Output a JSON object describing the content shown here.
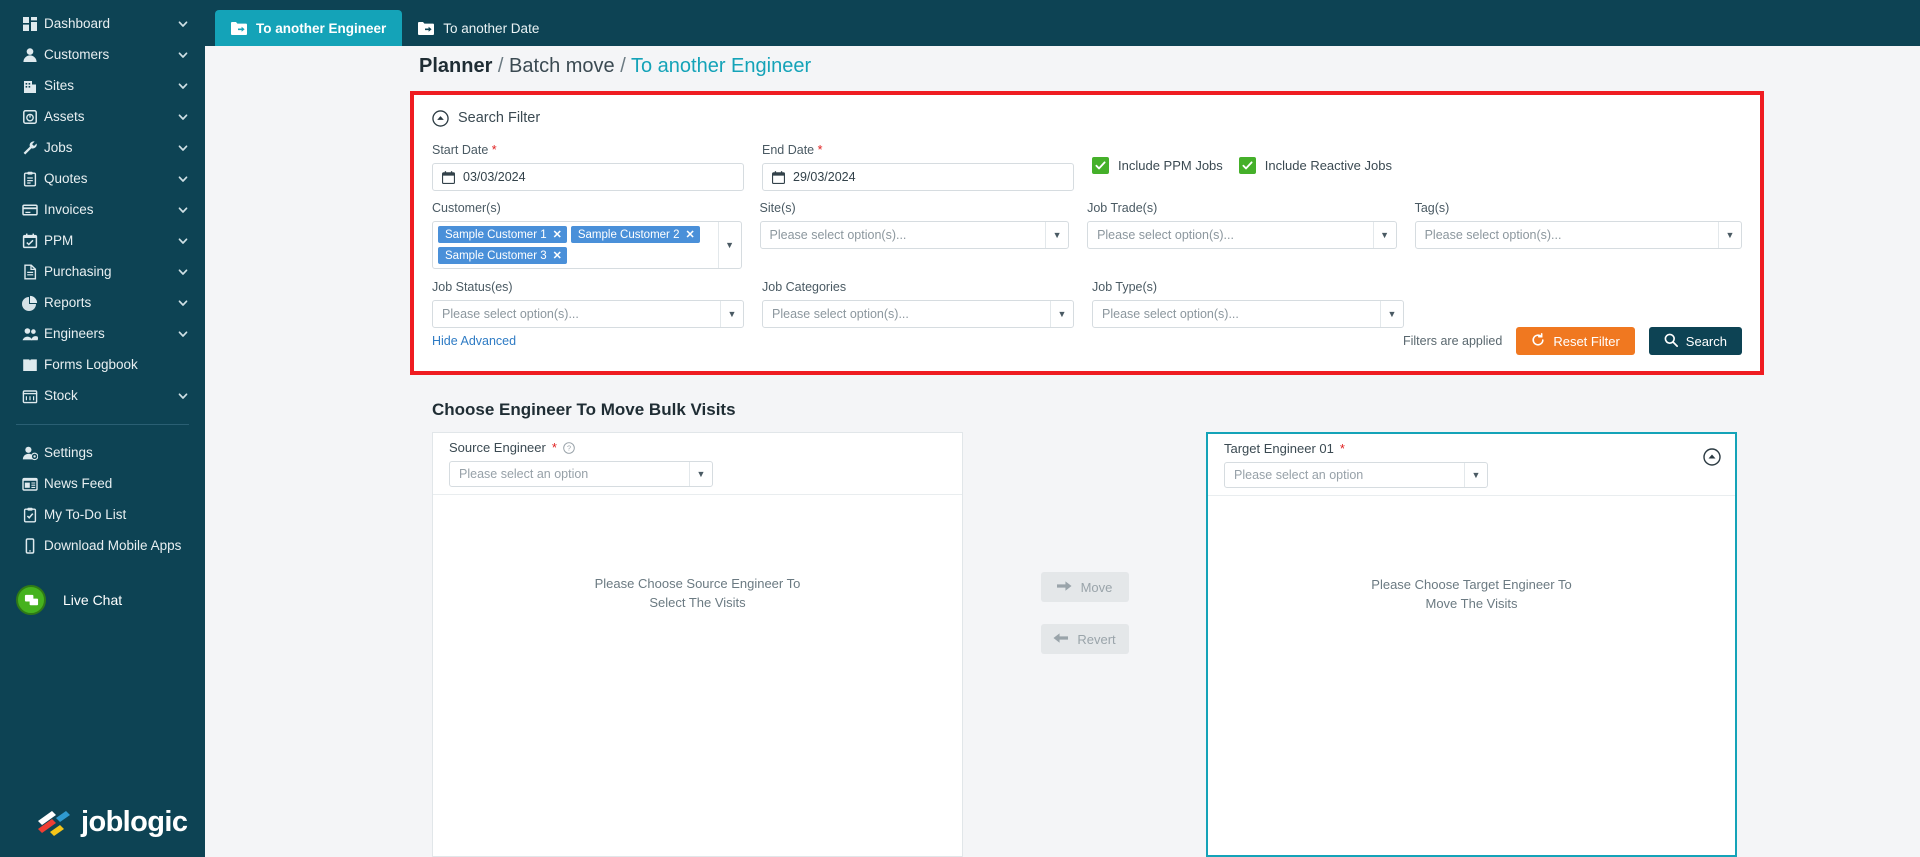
{
  "sidebar": {
    "items": [
      {
        "label": "Dashboard",
        "icon": "dashboard-icon",
        "caret": true
      },
      {
        "label": "Customers",
        "icon": "customers-icon",
        "caret": true
      },
      {
        "label": "Sites",
        "icon": "sites-icon",
        "caret": true
      },
      {
        "label": "Assets",
        "icon": "assets-icon",
        "caret": true
      },
      {
        "label": "Jobs",
        "icon": "jobs-icon",
        "caret": true
      },
      {
        "label": "Quotes",
        "icon": "quotes-icon",
        "caret": true
      },
      {
        "label": "Invoices",
        "icon": "invoices-icon",
        "caret": true
      },
      {
        "label": "PPM",
        "icon": "ppm-icon",
        "caret": true
      },
      {
        "label": "Purchasing",
        "icon": "purchasing-icon",
        "caret": true
      },
      {
        "label": "Reports",
        "icon": "reports-icon",
        "caret": true
      },
      {
        "label": "Engineers",
        "icon": "engineers-icon",
        "caret": true
      },
      {
        "label": "Forms Logbook",
        "icon": "forms-logbook-icon",
        "caret": false
      },
      {
        "label": "Stock",
        "icon": "stock-icon",
        "caret": true
      }
    ],
    "secondary_items": [
      {
        "label": "Settings",
        "icon": "settings-icon"
      },
      {
        "label": "News Feed",
        "icon": "news-feed-icon"
      },
      {
        "label": "My To-Do List",
        "icon": "todo-list-icon"
      },
      {
        "label": "Download Mobile Apps",
        "icon": "mobile-app-icon"
      }
    ],
    "live_chat": {
      "label": "Live Chat",
      "icon": "chat-bubble-icon",
      "color": "#46b21e"
    },
    "brand": {
      "name": "joblogic",
      "icon": "joblogic-logo-icon"
    },
    "background": "#0d4354"
  },
  "topbar": {
    "tabs": [
      {
        "label": "To another Engineer",
        "icon": "move-folder-icon",
        "active": true
      },
      {
        "label": "To another Date",
        "icon": "move-folder-icon",
        "active": false
      }
    ],
    "accent": "#14a3b8"
  },
  "breadcrumb": {
    "root": "Planner",
    "sep1": "/",
    "middle": "Batch move",
    "sep2": "/",
    "current": "To another Engineer"
  },
  "search_filter": {
    "title": "Search Filter",
    "collapse_icon": "collapse-up-icon",
    "highlight_color": "#ef1c21",
    "start_date": {
      "label": "Start Date",
      "required": true,
      "value": "03/03/2024",
      "icon": "calendar-icon"
    },
    "end_date": {
      "label": "End Date",
      "required": true,
      "value": "29/03/2024",
      "icon": "calendar-icon"
    },
    "checkboxes": [
      {
        "label": "Include PPM Jobs",
        "checked": true,
        "color": "#45b02a"
      },
      {
        "label": "Include Reactive Jobs",
        "checked": true,
        "color": "#45b02a"
      }
    ],
    "customers": {
      "label": "Customer(s)",
      "tags": [
        "Sample Customer 1",
        "Sample Customer 2",
        "Sample Customer 3"
      ],
      "remove_icon": "close-x-icon"
    },
    "row1": [
      {
        "label": "Site(s)",
        "placeholder": "Please select option(s)..."
      },
      {
        "label": "Job Trade(s)",
        "placeholder": "Please select option(s)..."
      },
      {
        "label": "Tag(s)",
        "placeholder": "Please select option(s)..."
      }
    ],
    "row2": [
      {
        "label": "Job Status(es)",
        "placeholder": "Please select option(s)..."
      },
      {
        "label": "Job Categories",
        "placeholder": "Please select option(s)..."
      },
      {
        "label": "Job Type(s)",
        "placeholder": "Please select option(s)..."
      }
    ],
    "hide_advanced": "Hide Advanced",
    "applied_text": "Filters are applied",
    "reset_button": {
      "label": "Reset Filter",
      "icon": "refresh-icon",
      "color": "#f07820"
    },
    "search_button": {
      "label": "Search",
      "icon": "search-icon",
      "color": "#0d4354"
    }
  },
  "engineer_section": {
    "title": "Choose Engineer To Move Bulk Visits",
    "source": {
      "label": "Source Engineer",
      "required": true,
      "help_icon": "help-circle-icon",
      "placeholder": "Please select an option",
      "empty_message_line1": "Please Choose Source Engineer To",
      "empty_message_line2": "Select The Visits"
    },
    "target": {
      "label": "Target Engineer 01",
      "required": true,
      "placeholder": "Please select an option",
      "empty_message_line1": "Please Choose Target Engineer To",
      "empty_message_line2": "Move The Visits",
      "collapse_icon": "collapse-up-icon",
      "border_color": "#14a3b8"
    },
    "move_button": {
      "label": "Move",
      "icon": "arrow-right-icon"
    },
    "revert_button": {
      "label": "Revert",
      "icon": "arrow-left-icon"
    }
  }
}
